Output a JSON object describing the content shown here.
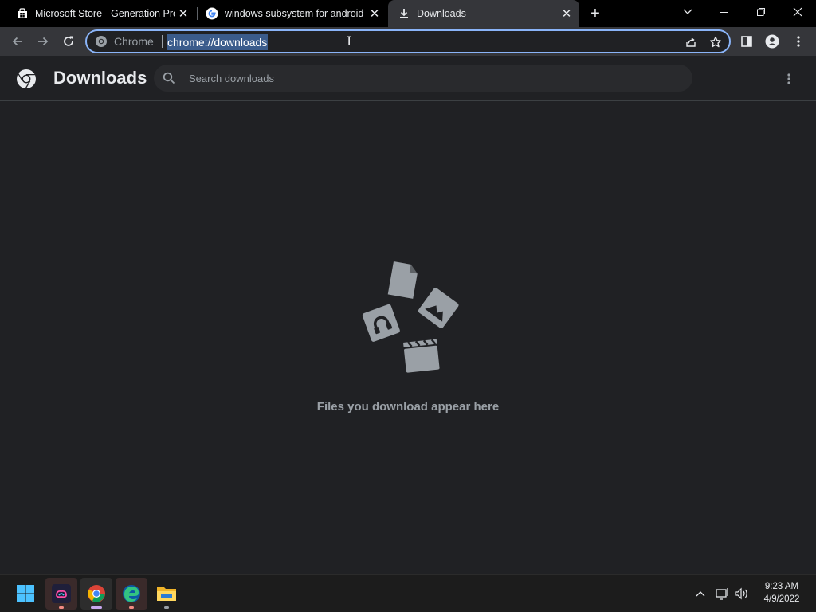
{
  "tabs": [
    {
      "title": "Microsoft Store - Generation Proj",
      "icon": "microsoft-store-icon",
      "close": "✕"
    },
    {
      "title": "windows subsystem for android s",
      "icon": "google-icon",
      "close": "✕"
    },
    {
      "title": "Downloads",
      "icon": "download-icon",
      "close": "✕"
    }
  ],
  "new_tab": "+",
  "omnibox": {
    "site_label": "Chrome",
    "url": "chrome://downloads"
  },
  "downloads_page": {
    "title": "Downloads",
    "search_placeholder": "Search downloads",
    "empty_message": "Files you download appear here"
  },
  "taskbar": {
    "apps": [
      "start-icon",
      "creative-cloud-icon",
      "chrome-icon",
      "edge-icon",
      "file-explorer-icon"
    ],
    "time": "9:23 AM",
    "date": "4/9/2022"
  },
  "colors": {
    "accent": "#8ab4f8",
    "page_bg": "#202124",
    "toolbar_bg": "#35363a",
    "tabstrip_bg": "#000000"
  }
}
